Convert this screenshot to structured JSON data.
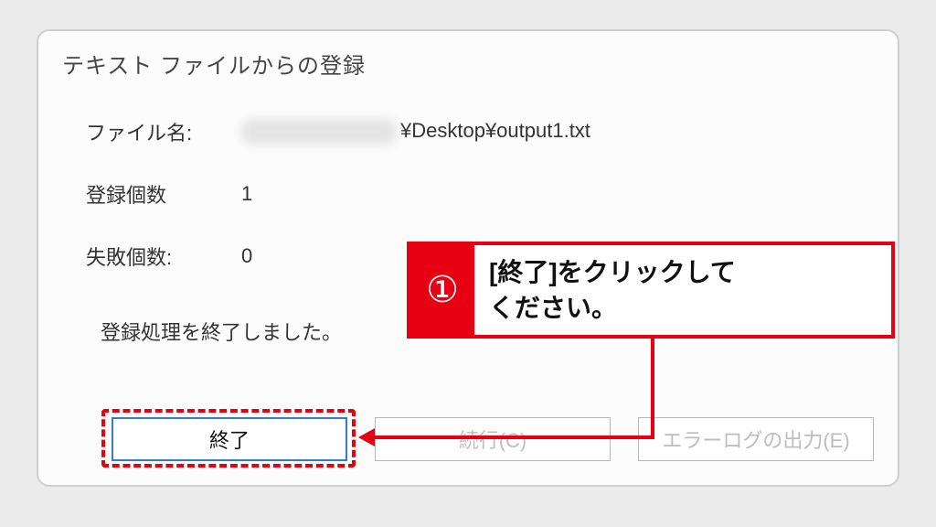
{
  "dialog": {
    "title": "テキスト ファイルからの登録",
    "file_label": "ファイル名:",
    "file_path_suffix": "¥Desktop¥output1.txt",
    "registered_label": "登録個数",
    "registered_count": "1",
    "failed_label": "失敗個数:",
    "failed_count": "0",
    "status_message": "登録処理を終了しました。",
    "buttons": {
      "finish": "終了",
      "continue": "続行(C)",
      "export_log": "エラーログの出力(E)"
    }
  },
  "annotation": {
    "step_number": "①",
    "instruction": "[終了]をクリックして\nください。"
  }
}
